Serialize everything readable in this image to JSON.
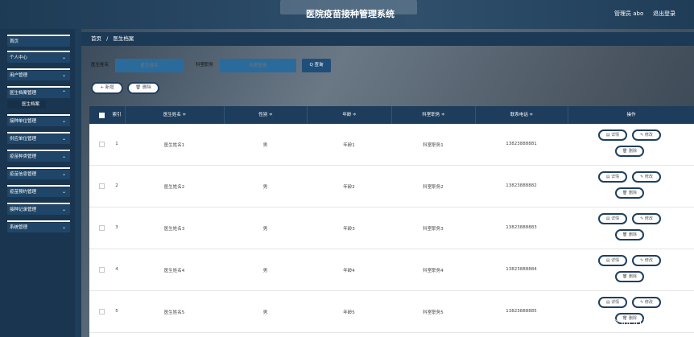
{
  "header": {
    "app_title": "医院疫苗接种管理系统",
    "user": "管理员 abo",
    "logout": "退出登录"
  },
  "sidebar": {
    "items": [
      {
        "label": "首页",
        "chevron": false
      },
      {
        "label": "个人中心",
        "chevron": true
      },
      {
        "label": "用户管理",
        "chevron": true
      },
      {
        "label": "医生档案管理",
        "chevron": true
      },
      {
        "label": "接种单位管理",
        "chevron": true
      },
      {
        "label": "供应单位管理",
        "chevron": true
      },
      {
        "label": "疫苗种类管理",
        "chevron": true
      },
      {
        "label": "疫苗信息管理",
        "chevron": true
      },
      {
        "label": "疫苗预约管理",
        "chevron": true
      },
      {
        "label": "接种记录管理",
        "chevron": true
      },
      {
        "label": "系统管理",
        "chevron": true
      }
    ],
    "sub_item": "医生档案"
  },
  "breadcrumb": {
    "home": "首页",
    "separator": "/",
    "current": "医生档案"
  },
  "search": {
    "name_label": "医生姓名",
    "name_placeholder": "医生姓名",
    "dept_label": "科室职务",
    "dept_placeholder": "科室职务",
    "query_button": "Q 查询"
  },
  "actions": {
    "add": "+ 新增",
    "delete": "🗑 删除"
  },
  "table": {
    "columns": [
      "索引",
      "医生姓名 ≑",
      "性别 ≑",
      "年龄 ≑",
      "科室职务 ≑",
      "联系电话 ≑",
      "操作"
    ],
    "rows": [
      {
        "index": "1",
        "name": "医生姓名1",
        "gender": "男",
        "age": "年龄1",
        "dept": "科室职务1",
        "phone": "13823888881"
      },
      {
        "index": "2",
        "name": "医生姓名2",
        "gender": "男",
        "age": "年龄2",
        "dept": "科室职务2",
        "phone": "13823888882"
      },
      {
        "index": "3",
        "name": "医生姓名3",
        "gender": "男",
        "age": "年龄3",
        "dept": "科室职务3",
        "phone": "13823888883"
      },
      {
        "index": "4",
        "name": "医生姓名4",
        "gender": "男",
        "age": "年龄4",
        "dept": "科室职务4",
        "phone": "13823888884"
      },
      {
        "index": "5",
        "name": "医生姓名5",
        "gender": "男",
        "age": "年龄5",
        "dept": "科室职务5",
        "phone": "13823888885"
      }
    ],
    "op_detail": "▤ 详情",
    "op_edit": "✎ 修改",
    "op_delete": "🗑 删除"
  },
  "watermark": "CSDN @Shejl1214"
}
